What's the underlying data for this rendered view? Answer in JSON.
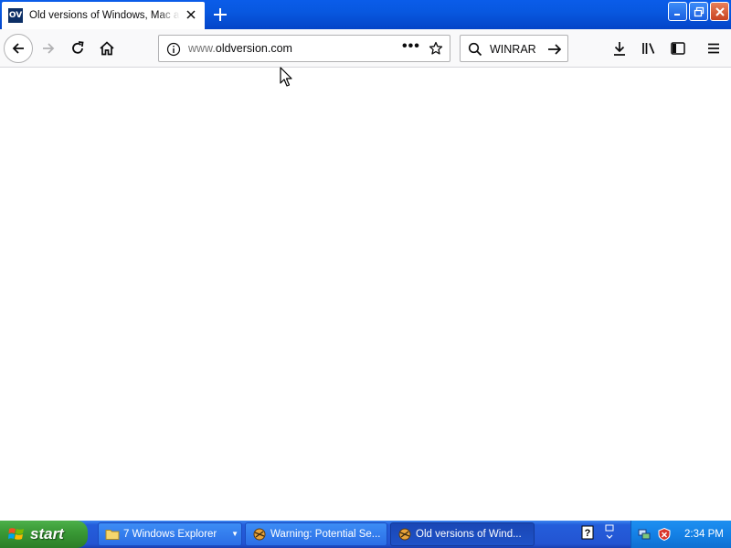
{
  "browser": {
    "tab": {
      "favicon_text": "OV",
      "title": "Old versions of Windows, Mac and Linux Software"
    },
    "urlbar": {
      "url_prefix": "www.",
      "url_domain": "oldversion.com"
    },
    "searchbar": {
      "value": "WINRAR"
    }
  },
  "taskbar": {
    "start_label": "start",
    "tasks": [
      {
        "label": "7 Windows Explorer"
      },
      {
        "label": "Warning: Potential Se..."
      },
      {
        "label": "Old versions of Wind..."
      }
    ],
    "clock": "2:34 PM"
  },
  "colors": {
    "titlebar": "#0858e0",
    "taskbar": "#245edb",
    "start_button": "#3a9a36",
    "tray": "#1481e6"
  }
}
